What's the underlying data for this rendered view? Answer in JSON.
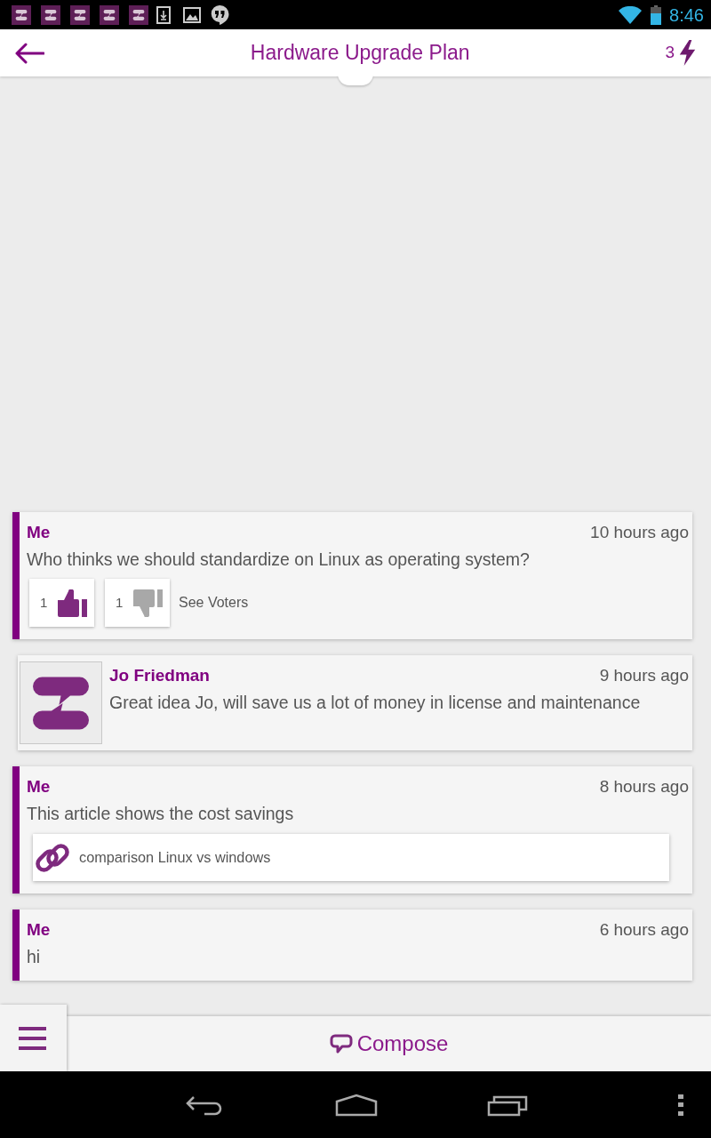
{
  "status_bar": {
    "time": "8:46"
  },
  "header": {
    "title": "Hardware Upgrade Plan",
    "count": "3"
  },
  "posts": [
    {
      "kind": "own",
      "author": "Me",
      "time": "10 hours ago",
      "text": "Who thinks we should standardize on Linux as operating system?",
      "votes": [
        {
          "kind": "up",
          "count": "1",
          "selected": true
        },
        {
          "kind": "down",
          "count": "1",
          "selected": false
        }
      ],
      "voters_link": "See Voters"
    },
    {
      "kind": "other",
      "author": "Jo Friedman",
      "time": "9 hours ago",
      "text": "Great idea Jo, will save us a lot of money in license and maintenance"
    },
    {
      "kind": "own",
      "author": "Me",
      "time": "8 hours ago",
      "text": "This article shows the cost savings",
      "attachment": {
        "title": "comparison Linux vs windows"
      }
    },
    {
      "kind": "own",
      "author": "Me",
      "time": "6 hours ago",
      "text": "hi"
    }
  ],
  "compose_bar": {
    "label": "Compose"
  }
}
